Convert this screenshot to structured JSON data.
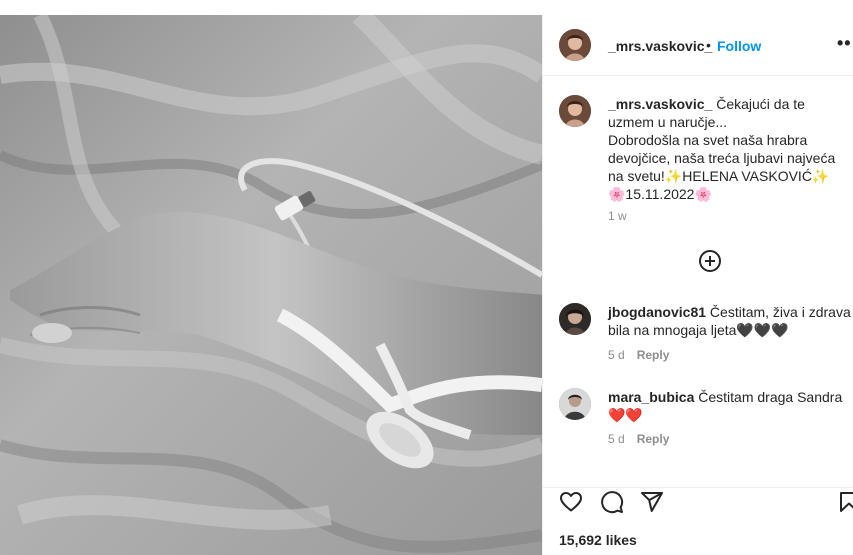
{
  "post": {
    "username": "_mrs.vaskovic_",
    "separator": "•",
    "follow_label": "Follow",
    "more_label": "••",
    "caption_line1": " Čekajući da te uzmem u naručje...",
    "caption_line2": "Dobrodošla na svet naša hrabra devojčice, naša treća ljubavi najveća na svetu!✨HELENA VASKOVIĆ✨",
    "caption_line3": "🌸15.11.2022🌸",
    "time": "1 w",
    "likes": "15,692 likes"
  },
  "comments": [
    {
      "username": "jbogdanovic81",
      "text": " Čestitam, živa i zdrava bila na mnogaja ljeta🖤🖤🖤",
      "time": "5 d",
      "reply_label": "Reply"
    },
    {
      "username": "mara_bubica",
      "text": " Čestitam draga Sandra❤️❤️",
      "time": "5 d",
      "reply_label": "Reply"
    }
  ],
  "icons": {
    "header_more": "more-options-icon",
    "load_more": "plus-circle-icon",
    "like": "heart-icon",
    "comment": "comment-icon",
    "share": "share-icon",
    "save": "bookmark-icon"
  },
  "colors": {
    "accent": "#0095f6",
    "secondary_text": "#8e8e8e",
    "divider": "#efefef"
  }
}
